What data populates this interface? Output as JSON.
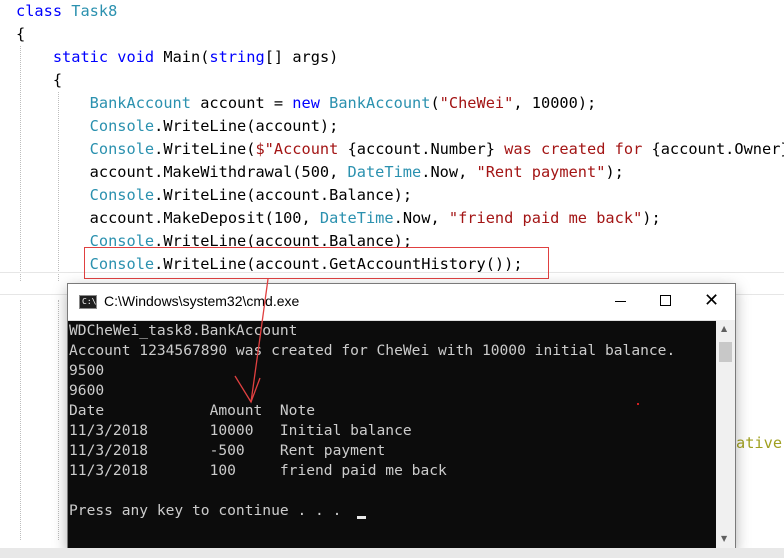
{
  "editor": {
    "lines": [
      [
        {
          "t": "class ",
          "c": "kw"
        },
        {
          "t": "Task8",
          "c": "ty"
        }
      ],
      [
        {
          "t": "{",
          "c": ""
        }
      ],
      [
        {
          "t": "    static void ",
          "c": "kw"
        },
        {
          "t": "Main(",
          "c": ""
        },
        {
          "t": "string",
          "c": "kw"
        },
        {
          "t": "[] args)",
          "c": ""
        }
      ],
      [
        {
          "t": "    {",
          "c": ""
        }
      ],
      [
        {
          "t": "        BankAccount",
          "c": "ty"
        },
        {
          "t": " account = ",
          "c": ""
        },
        {
          "t": "new ",
          "c": "kw"
        },
        {
          "t": "BankAccount",
          "c": "ty"
        },
        {
          "t": "(",
          "c": ""
        },
        {
          "t": "\"CheWei\"",
          "c": "str"
        },
        {
          "t": ", 10000);",
          "c": ""
        }
      ],
      [
        {
          "t": "        Console",
          "c": "ty"
        },
        {
          "t": ".WriteLine(account);",
          "c": ""
        }
      ],
      [
        {
          "t": "        Console",
          "c": "ty"
        },
        {
          "t": ".WriteLine(",
          "c": ""
        },
        {
          "t": "$\"Account ",
          "c": "str"
        },
        {
          "t": "{account.Number}",
          "c": ""
        },
        {
          "t": " was created for ",
          "c": "str"
        },
        {
          "t": "{account.Owner}",
          "c": ""
        }
      ],
      [
        {
          "t": "        account.MakeWithdrawal(500, ",
          "c": ""
        },
        {
          "t": "DateTime",
          "c": "ty"
        },
        {
          "t": ".Now, ",
          "c": ""
        },
        {
          "t": "\"Rent payment\"",
          "c": "str"
        },
        {
          "t": ");",
          "c": ""
        }
      ],
      [
        {
          "t": "        Console",
          "c": "ty"
        },
        {
          "t": ".WriteLine(account.Balance);",
          "c": ""
        }
      ],
      [
        {
          "t": "        account.MakeDeposit(100, ",
          "c": ""
        },
        {
          "t": "DateTime",
          "c": "ty"
        },
        {
          "t": ".Now, ",
          "c": ""
        },
        {
          "t": "\"friend paid me back\"",
          "c": "str"
        },
        {
          "t": ");",
          "c": ""
        }
      ],
      [
        {
          "t": "        Console",
          "c": "ty"
        },
        {
          "t": ".WriteLine(account.Balance);",
          "c": ""
        }
      ],
      [
        {
          "t": "        Console",
          "c": "ty"
        },
        {
          "t": ".WriteLine(account.GetAccountHistory());",
          "c": ""
        }
      ]
    ],
    "partial_right": "ative"
  },
  "cmd": {
    "title": "C:\\Windows\\system32\\cmd.exe",
    "icon_text": "C:\\",
    "close_glyph": "✕",
    "output": [
      "WDCheWei_task8.BankAccount",
      "Account 1234567890 was created for CheWei with 10000 initial balance.",
      "9500",
      "9600",
      "Date            Amount  Note",
      "11/3/2018       10000   Initial balance",
      "11/3/2018       -500    Rent payment",
      "11/3/2018       100     friend paid me back",
      "",
      "Press any key to continue . . . "
    ]
  },
  "colors": {
    "keyword": "#0000ff",
    "type": "#2b91af",
    "string": "#a31515",
    "highlight_box": "#e04040",
    "console_bg": "#0c0c0c",
    "console_text": "#cccccc"
  }
}
